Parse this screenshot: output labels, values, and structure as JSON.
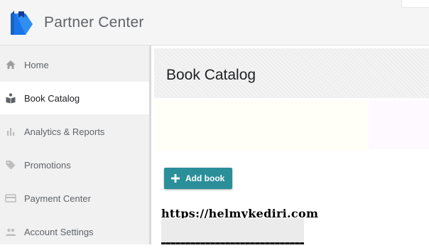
{
  "app": {
    "title": "Partner Center",
    "logo": "google-play-books-logo",
    "colors": {
      "header_bg": "#f5f5f5",
      "sidebar_bg": "#f1f1f1",
      "accent": "#2b8f9a",
      "logo_blue": "#1a73e8"
    }
  },
  "sidebar": {
    "items": [
      {
        "label": "Home",
        "icon": "home-icon",
        "active": false
      },
      {
        "label": "Book Catalog",
        "icon": "book-catalog-icon",
        "active": true
      },
      {
        "label": "Analytics & Reports",
        "icon": "bar-chart-icon",
        "active": false
      },
      {
        "label": "Promotions",
        "icon": "tag-icon",
        "active": false
      },
      {
        "label": "Payment Center",
        "icon": "credit-card-icon",
        "active": false
      },
      {
        "label": "Account Settings",
        "icon": "people-icon",
        "active": false
      }
    ]
  },
  "main": {
    "page_title": "Book Catalog",
    "add_book_label": "Add book",
    "add_book_icon": "plus-icon"
  },
  "overlay": {
    "watermark": "https://helmykediri.com"
  }
}
